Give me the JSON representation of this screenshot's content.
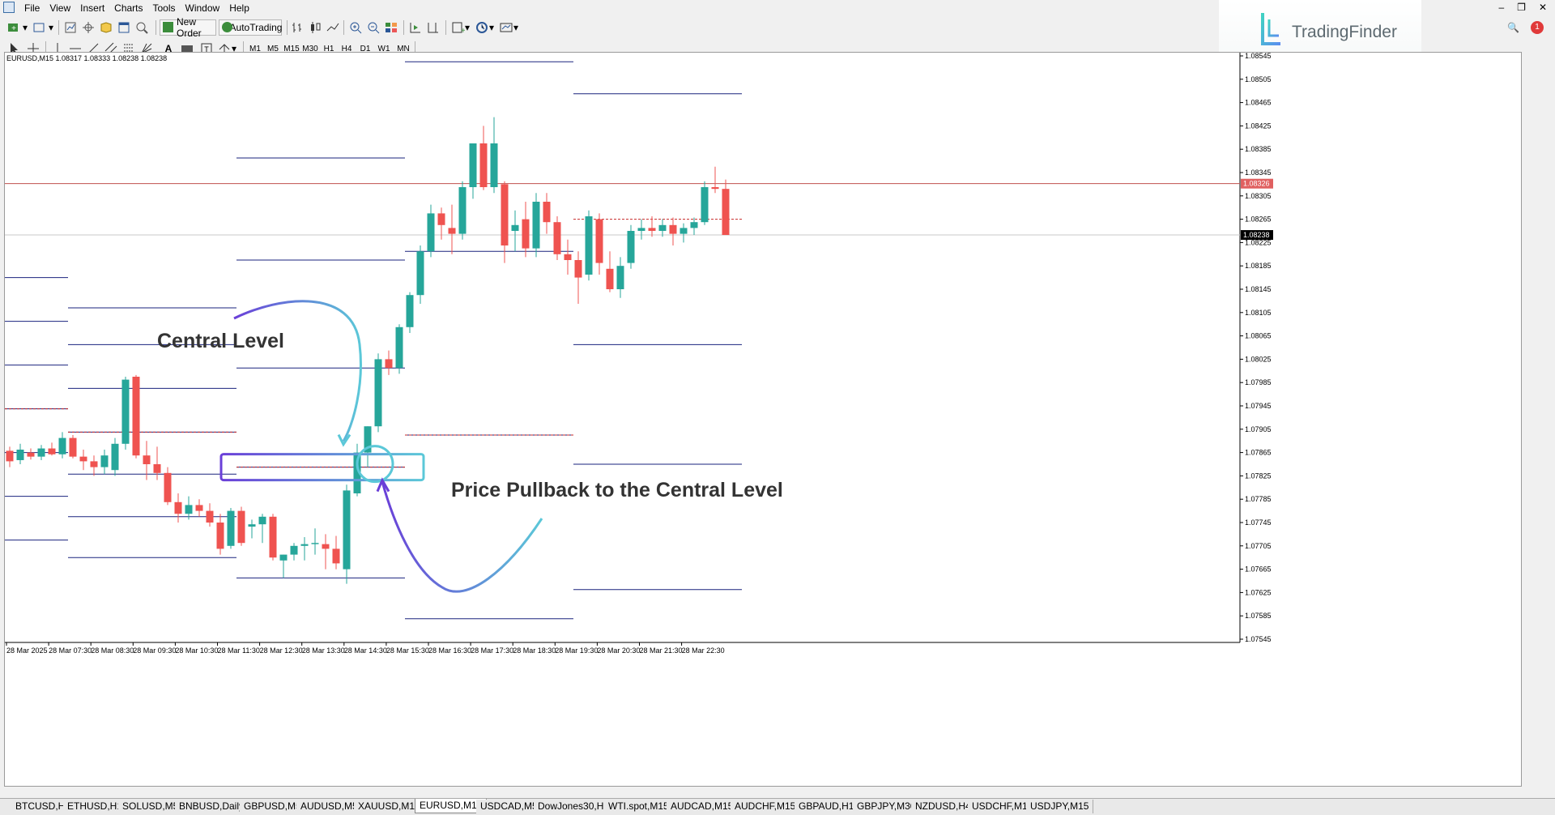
{
  "menu": [
    "File",
    "View",
    "Insert",
    "Charts",
    "Tools",
    "Window",
    "Help"
  ],
  "toolbar": {
    "new_order_label": "New Order",
    "autotrading_label": "AutoTrading",
    "timeframes": [
      "M1",
      "M5",
      "M15",
      "M30",
      "H1",
      "H4",
      "D1",
      "W1",
      "MN"
    ]
  },
  "brand": {
    "name": "TradingFinder",
    "notification_count": "1"
  },
  "chart": {
    "symbol_line": "EURUSD,M15  1.08317 1.08333 1.08238 1.08238",
    "price_labels": [
      "1.08545",
      "1.08505",
      "1.08465",
      "1.08425",
      "1.08385",
      "1.08345",
      "1.08305",
      "1.08265",
      "1.08225",
      "1.08185",
      "1.08145",
      "1.08105",
      "1.08065",
      "1.08025",
      "1.07985",
      "1.07945",
      "1.07905",
      "1.07865",
      "1.07825",
      "1.07785",
      "1.07745",
      "1.07705",
      "1.07665",
      "1.07625",
      "1.07585",
      "1.07545"
    ],
    "current_price_tag": "1.08326",
    "bid_price_tag": "1.08238",
    "time_labels": [
      "28 Mar 2025",
      "28 Mar 07:30",
      "28 Mar 08:30",
      "28 Mar 09:30",
      "28 Mar 10:30",
      "28 Mar 11:30",
      "28 Mar 12:30",
      "28 Mar 13:30",
      "28 Mar 14:30",
      "28 Mar 15:30",
      "28 Mar 16:30",
      "28 Mar 17:30",
      "28 Mar 18:30",
      "28 Mar 19:30",
      "28 Mar 20:30",
      "28 Mar 21:30",
      "28 Mar 22:30"
    ],
    "annotation_central": "Central Level",
    "annotation_pullback": "Price Pullback to the Central Level",
    "colors": {
      "bull": "#26a69a",
      "bear": "#ef5350",
      "level": "#1a237e",
      "central_dotted": "#c62828",
      "arrow_cyan": "#5bc8d8",
      "arrow_purple": "#6a3fd8"
    }
  },
  "chart_data": {
    "type": "candlestick",
    "symbol": "EURUSD",
    "timeframe": "M15",
    "ohlc_header": {
      "open": 1.08317,
      "high": 1.08333,
      "low": 1.08238,
      "close": 1.08238
    },
    "candles": [
      [
        1.07868,
        1.07875,
        1.0784,
        1.0785
      ],
      [
        1.07852,
        1.0788,
        1.07845,
        1.0787
      ],
      [
        1.07865,
        1.07872,
        1.07853,
        1.07858
      ],
      [
        1.07858,
        1.07878,
        1.07852,
        1.07872
      ],
      [
        1.07872,
        1.07882,
        1.0786,
        1.07862
      ],
      [
        1.07862,
        1.079,
        1.07855,
        1.0789
      ],
      [
        1.0789,
        1.07895,
        1.07855,
        1.07858
      ],
      [
        1.07858,
        1.0787,
        1.07835,
        1.0785
      ],
      [
        1.0785,
        1.0786,
        1.07825,
        1.0784
      ],
      [
        1.0784,
        1.0787,
        1.07828,
        1.0786
      ],
      [
        1.07835,
        1.0789,
        1.07825,
        1.0788
      ],
      [
        1.0788,
        1.07995,
        1.0787,
        1.0799
      ],
      [
        1.07995,
        1.07998,
        1.07855,
        1.0786
      ],
      [
        1.0786,
        1.07885,
        1.07818,
        1.07845
      ],
      [
        1.07845,
        1.07875,
        1.07818,
        1.0783
      ],
      [
        1.0783,
        1.0784,
        1.07775,
        1.0778
      ],
      [
        1.0778,
        1.07795,
        1.07745,
        1.0776
      ],
      [
        1.0776,
        1.0779,
        1.0775,
        1.07775
      ],
      [
        1.07775,
        1.07785,
        1.07755,
        1.07765
      ],
      [
        1.07765,
        1.07778,
        1.07738,
        1.07745
      ],
      [
        1.07745,
        1.0776,
        1.0769,
        1.077
      ],
      [
        1.07705,
        1.0777,
        1.077,
        1.07765
      ],
      [
        1.07765,
        1.07772,
        1.07705,
        1.0771
      ],
      [
        1.07738,
        1.0775,
        1.07718,
        1.07742
      ],
      [
        1.07742,
        1.0776,
        1.0771,
        1.07755
      ],
      [
        1.07755,
        1.0776,
        1.0768,
        1.07685
      ],
      [
        1.0768,
        1.0769,
        1.0765,
        1.0769
      ],
      [
        1.0769,
        1.0771,
        1.0768,
        1.07705
      ],
      [
        1.07705,
        1.0772,
        1.0768,
        1.07708
      ],
      [
        1.07708,
        1.07735,
        1.0769,
        1.0771
      ],
      [
        1.07708,
        1.07725,
        1.07665,
        1.077
      ],
      [
        1.077,
        1.07722,
        1.07665,
        1.07675
      ],
      [
        1.07665,
        1.0781,
        1.0764,
        1.078
      ],
      [
        1.07795,
        1.0788,
        1.0779,
        1.07865
      ],
      [
        1.07865,
        1.0791,
        1.0784,
        1.0791
      ],
      [
        1.0791,
        1.08035,
        1.079,
        1.08025
      ],
      [
        1.08025,
        1.0804,
        1.07998,
        1.0801
      ],
      [
        1.0801,
        1.08085,
        1.08,
        1.0808
      ],
      [
        1.0808,
        1.0814,
        1.0807,
        1.08135
      ],
      [
        1.08135,
        1.0822,
        1.0812,
        1.0821
      ],
      [
        1.0821,
        1.0829,
        1.082,
        1.08275
      ],
      [
        1.08275,
        1.08285,
        1.0823,
        1.08255
      ],
      [
        1.0825,
        1.0829,
        1.08205,
        1.0824
      ],
      [
        1.0824,
        1.0833,
        1.0823,
        1.0832
      ],
      [
        1.0832,
        1.08395,
        1.083,
        1.08395
      ],
      [
        1.08395,
        1.08425,
        1.08315,
        1.0832
      ],
      [
        1.0832,
        1.0844,
        1.0831,
        1.08395
      ],
      [
        1.08325,
        1.0833,
        1.0819,
        1.0822
      ],
      [
        1.08245,
        1.0828,
        1.0821,
        1.08255
      ],
      [
        1.08265,
        1.08295,
        1.082,
        1.08215
      ],
      [
        1.08215,
        1.0831,
        1.082,
        1.08295
      ],
      [
        1.08295,
        1.0831,
        1.0824,
        1.0826
      ],
      [
        1.0826,
        1.0827,
        1.08195,
        1.08205
      ],
      [
        1.08205,
        1.0823,
        1.0817,
        1.08195
      ],
      [
        1.08195,
        1.0821,
        1.0812,
        1.08165
      ],
      [
        1.0817,
        1.0828,
        1.0816,
        1.0827
      ],
      [
        1.08265,
        1.08275,
        1.0817,
        1.0819
      ],
      [
        1.0818,
        1.0821,
        1.0814,
        1.08145
      ],
      [
        1.08145,
        1.082,
        1.0813,
        1.08185
      ],
      [
        1.0819,
        1.08255,
        1.0818,
        1.08245
      ],
      [
        1.08245,
        1.08265,
        1.0823,
        1.0825
      ],
      [
        1.0825,
        1.0827,
        1.08235,
        1.08245
      ],
      [
        1.08245,
        1.08265,
        1.08235,
        1.08255
      ],
      [
        1.08255,
        1.08268,
        1.0822,
        1.0824
      ],
      [
        1.0824,
        1.08258,
        1.08225,
        1.0825
      ],
      [
        1.0825,
        1.08268,
        1.08238,
        1.0826
      ],
      [
        1.0826,
        1.0833,
        1.08255,
        1.0832
      ],
      [
        1.0832,
        1.08355,
        1.0831,
        1.08317
      ],
      [
        1.08317,
        1.08333,
        1.08238,
        1.08238
      ]
    ],
    "levels": [
      {
        "x_from": 0,
        "x_to": 6,
        "y": [
          1.08165,
          1.0809,
          1.08015,
          1.0794,
          1.07865,
          1.0779,
          1.07715
        ],
        "central": 1.0794
      },
      {
        "x_from": 6,
        "x_to": 22,
        "y": [
          1.08113,
          1.0805,
          1.07975,
          1.079,
          1.07828,
          1.07755,
          1.07685
        ],
        "central": 1.079
      },
      {
        "x_from": 22,
        "x_to": 38,
        "y": [
          1.0837,
          1.08195,
          1.0801,
          1.0784,
          1.0765
        ],
        "central": 1.0784
      },
      {
        "x_from": 38,
        "x_to": 54,
        "y": [
          1.08535,
          1.0821,
          1.07895,
          1.0758
        ],
        "central": 1.07895
      },
      {
        "x_from": 54,
        "x_to": 70,
        "y": [
          1.0848,
          1.0805,
          1.07845,
          1.0763
        ],
        "central": 1.08265
      }
    ],
    "current_price": 1.08326,
    "bid_price": 1.08238,
    "ylim": [
      1.07545,
      1.08545
    ],
    "grid": false
  }
}
